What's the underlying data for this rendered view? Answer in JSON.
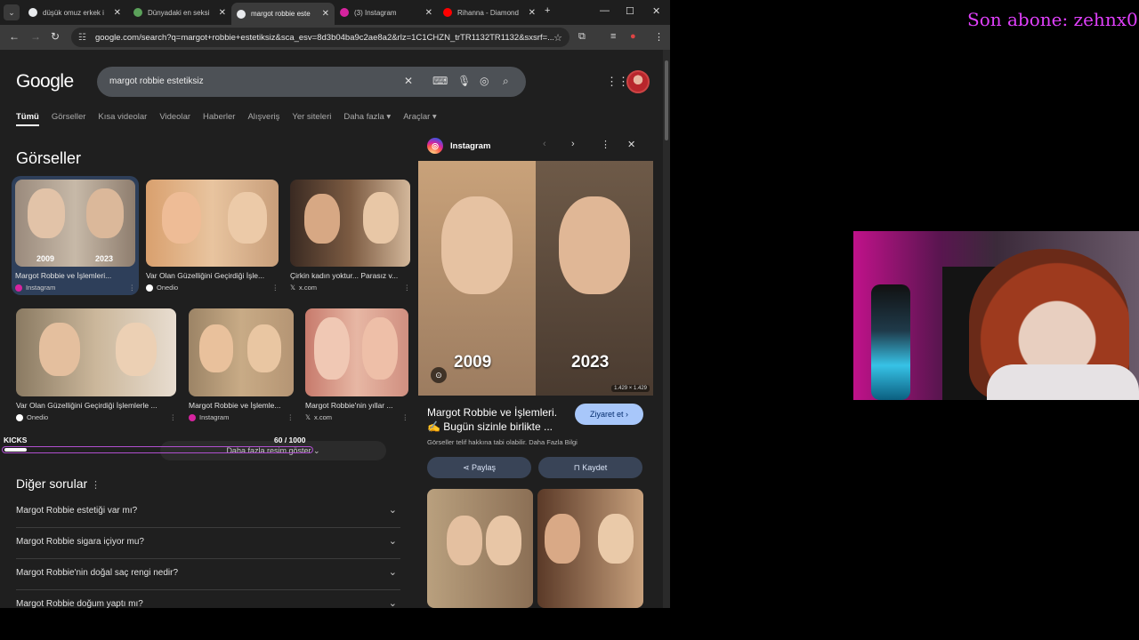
{
  "browser": {
    "tabs": [
      {
        "title": "düşük omuz erkek i",
        "fav_color": "#e8eaed",
        "active": false
      },
      {
        "title": "Dünyadaki en seksi",
        "fav_color": "#5ba15a",
        "active": false
      },
      {
        "title": "margot robbie este",
        "fav_color": "#e8eaed",
        "active": true
      },
      {
        "title": "(3) Instagram",
        "fav_color": "#d6249f",
        "active": false
      },
      {
        "title": "Rihanna - Diamond",
        "fav_color": "#ff0000",
        "active": false
      }
    ],
    "url": "google.com/search?q=margot+robbie+estetiksiz&sca_esv=8d3b04ba9c2ae8a2&rlz=1C1CHZN_trTR1132TR1132&sxsrf=..."
  },
  "google": {
    "logo": "Google",
    "query": "margot robbie estetiksiz",
    "tabs": [
      "Tümü",
      "Görseller",
      "Kısa videolar",
      "Videolar",
      "Haberler",
      "Alışveriş",
      "Yer siteleri",
      "Daha fazla ▾",
      "Araçlar ▾"
    ],
    "images_title": "Görseller",
    "images_row1": [
      {
        "caption": "Margot Robbie ve İşlemleri...",
        "source": "Instagram",
        "src_color": "#d6249f",
        "years": [
          "2009",
          "2023"
        ]
      },
      {
        "caption": "Var Olan Güzelliğini Geçirdiği İşle...",
        "source": "Onedio",
        "src_color": "#ffffff"
      },
      {
        "caption": "Çirkin kadın yoktur... Parasız v...",
        "source": "x.com",
        "src_color": "#000000"
      }
    ],
    "images_row2": [
      {
        "caption": "Var Olan Güzelliğini Geçirdiği İşlemlerle ...",
        "source": "Onedio",
        "src_color": "#ffffff"
      },
      {
        "caption": "Margot Robbie ve İşlemle...",
        "source": "Instagram",
        "src_color": "#d6249f"
      },
      {
        "caption": "Margot Robbie'nin yıllar ...",
        "source": "x.com",
        "src_color": "#000000"
      }
    ],
    "more_images": "Daha fazla resim göster",
    "other_questions_title": "Diğer sorular",
    "questions": [
      "Margot Robbie estetiği var mı?",
      "Margot Robbie sigara içiyor mu?",
      "Margot Robbie'nin doğal saç rengi nedir?",
      "Margot Robbie doğum yaptı mı?"
    ]
  },
  "kicks": {
    "label": "KICKS",
    "count": "60  / 1000",
    "progress": 0.06
  },
  "panel": {
    "source": "Instagram",
    "years": [
      "2009",
      "2023"
    ],
    "resolution": "1.429 × 1.429",
    "title": "Margot Robbie ve İşlemleri. ✍️ Bugün sizinle birlikte ...",
    "visit": "Ziyaret et ›",
    "copyright": "Görseller telif hakkına tabi olabilir. Daha Fazla Bilgi",
    "share": "Paylaş",
    "save": "Kaydet"
  },
  "stream": {
    "overlay": "Son abone: zehnx0"
  }
}
